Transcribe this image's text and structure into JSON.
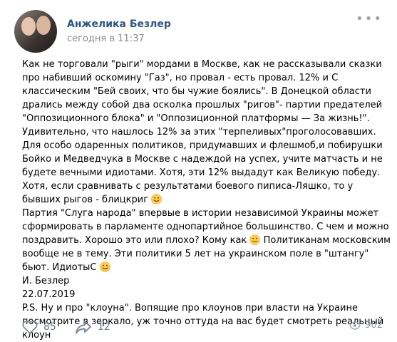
{
  "post": {
    "author": "Анжелика Безлер",
    "time": "сегодня в 11:37",
    "more": "•••",
    "paragraph_1": "Как не торговали \"рыги\" мордами в Москве, как не рассказывали сказки про набивший оскомину \"Газ\", но провал - есть провал. 12% и С классическим \"Бей своих, что бы чужие боялись\". В Донецкой области дрались между собой два осколка прошлых \"ригов\"- партии предателей \"Оппозиционного блока\" и \"Оппозиционной платформы — За жизнь!\". Удивительно, что нашлось 12% за этих \"терпеливых\"проголосовавших. Для особо одаренных политиков, придумавших и флешмоб,и побирушки Бойко и Медведчука в Москве с надеждой на успех, учите матчасть и не будете вечными идиотами. Хотя, эти 12% выдадут как Великую победу. Хотя, если сравнивать с результатами боевого пиписа-Ляшко, то у бывших рыгов - блицкриг",
    "paragraph_2a": "Партия \"Слуга народа\" впервые в истории независимой Украины может сформировать в парламенте однопартийное большинство. С чем и можно поздравить. Хорошо это или плохо? Кому как",
    "paragraph_2b": "Политиканам московским вообще не в тему. Эти политики 5 лет на украинском поле в \"штангу\" бьют. ИдиотыС",
    "signature": "И. Безлер",
    "date": "22.07.2019",
    "ps": "P.S. Ну и про \"клоуна\". Вопящие про клоунов при власти на Украине посмотрите в зеркало, уж точно оттуда на вас будет смотреть реальный клоун"
  },
  "footer": {
    "likes": "85",
    "shares": "12",
    "views": "902"
  },
  "icons": {
    "like": "heart-icon",
    "share": "share-icon",
    "views": "eye-icon",
    "emoji": "smile-emoji-icon",
    "wink": "wink-emoji-icon"
  }
}
